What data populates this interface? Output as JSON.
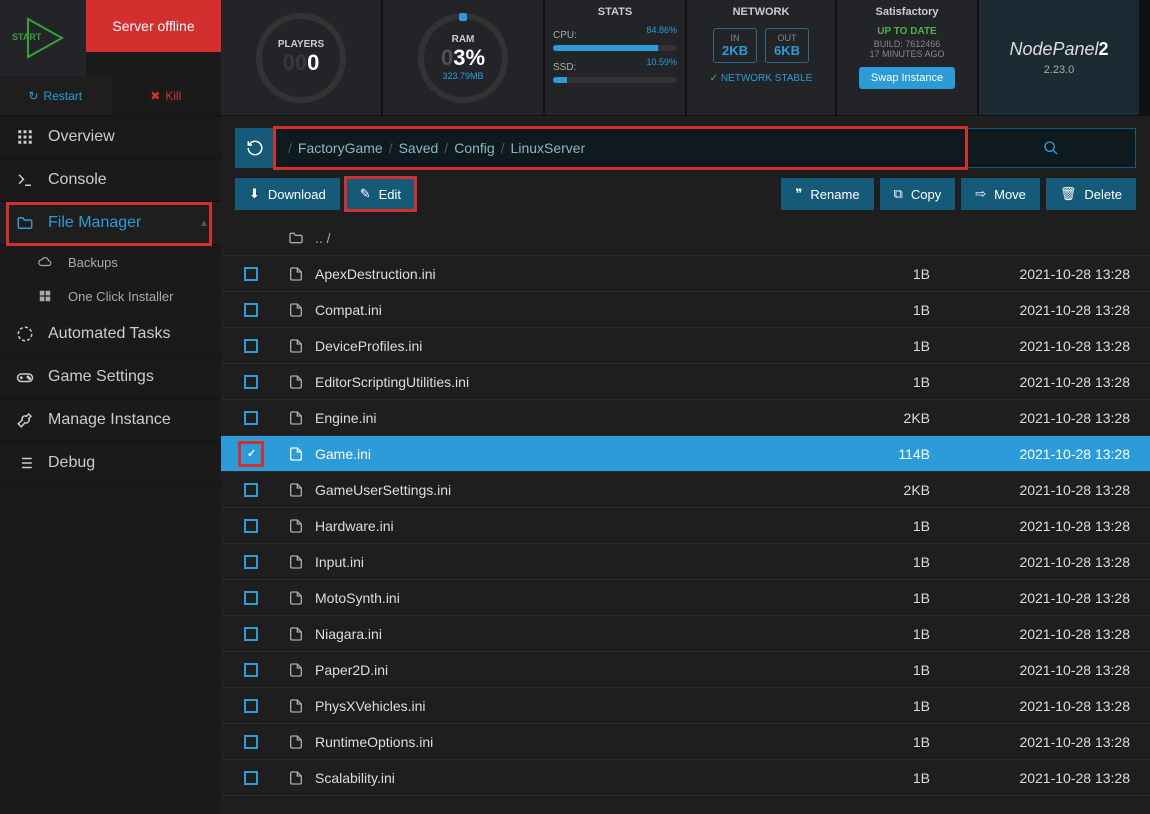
{
  "header": {
    "start_label": "START",
    "server_status": "Server offline",
    "restart": "Restart",
    "kill": "Kill",
    "players": {
      "title": "PLAYERS",
      "value": "0"
    },
    "ram": {
      "title": "RAM",
      "value": "3%",
      "sub": "323.79MB"
    },
    "stats": {
      "title": "STATS",
      "cpu_label": "CPU:",
      "cpu_val": "84.86%",
      "cpu_pct": 85,
      "ssd_label": "SSD:",
      "ssd_val": "10.59%",
      "ssd_pct": 11
    },
    "network": {
      "title": "NETWORK",
      "in_label": "IN",
      "in_val": "2KB",
      "out_label": "OUT",
      "out_val": "6KB",
      "stable": "NETWORK STABLE"
    },
    "game": {
      "title": "Satisfactory",
      "status": "UP TO DATE",
      "build": "BUILD:  7612466",
      "ago": "17 MINUTES AGO",
      "swap": "Swap Instance"
    },
    "brand": {
      "name": "NodePanel",
      "suffix": "2",
      "version": "2.23.0"
    }
  },
  "sidebar": {
    "items": [
      {
        "label": "Overview",
        "icon": "grid"
      },
      {
        "label": "Console",
        "icon": "terminal"
      },
      {
        "label": "File Manager",
        "icon": "folder",
        "active": true,
        "highlighted": true
      },
      {
        "label": "Backups",
        "icon": "cloud",
        "sub": true
      },
      {
        "label": "One Click Installer",
        "icon": "grid4",
        "sub": true
      },
      {
        "label": "Automated Tasks",
        "icon": "tasks"
      },
      {
        "label": "Game Settings",
        "icon": "gamepad"
      },
      {
        "label": "Manage Instance",
        "icon": "wrench"
      },
      {
        "label": "Debug",
        "icon": "list"
      }
    ]
  },
  "path": {
    "segments": [
      "FactoryGame",
      "Saved",
      "Config",
      "LinuxServer"
    ]
  },
  "toolbar": {
    "download": "Download",
    "edit": "Edit",
    "rename": "Rename",
    "copy": "Copy",
    "move": "Move",
    "delete": "Delete"
  },
  "files": {
    "up_label": ".. /",
    "rows": [
      {
        "name": "ApexDestruction.ini",
        "size": "1B",
        "date": "2021-10-28 13:28"
      },
      {
        "name": "Compat.ini",
        "size": "1B",
        "date": "2021-10-28 13:28"
      },
      {
        "name": "DeviceProfiles.ini",
        "size": "1B",
        "date": "2021-10-28 13:28"
      },
      {
        "name": "EditorScriptingUtilities.ini",
        "size": "1B",
        "date": "2021-10-28 13:28"
      },
      {
        "name": "Engine.ini",
        "size": "2KB",
        "date": "2021-10-28 13:28"
      },
      {
        "name": "Game.ini",
        "size": "114B",
        "date": "2021-10-28 13:28",
        "selected": true
      },
      {
        "name": "GameUserSettings.ini",
        "size": "2KB",
        "date": "2021-10-28 13:28"
      },
      {
        "name": "Hardware.ini",
        "size": "1B",
        "date": "2021-10-28 13:28"
      },
      {
        "name": "Input.ini",
        "size": "1B",
        "date": "2021-10-28 13:28"
      },
      {
        "name": "MotoSynth.ini",
        "size": "1B",
        "date": "2021-10-28 13:28"
      },
      {
        "name": "Niagara.ini",
        "size": "1B",
        "date": "2021-10-28 13:28"
      },
      {
        "name": "Paper2D.ini",
        "size": "1B",
        "date": "2021-10-28 13:28"
      },
      {
        "name": "PhysXVehicles.ini",
        "size": "1B",
        "date": "2021-10-28 13:28"
      },
      {
        "name": "RuntimeOptions.ini",
        "size": "1B",
        "date": "2021-10-28 13:28"
      },
      {
        "name": "Scalability.ini",
        "size": "1B",
        "date": "2021-10-28 13:28"
      }
    ]
  }
}
